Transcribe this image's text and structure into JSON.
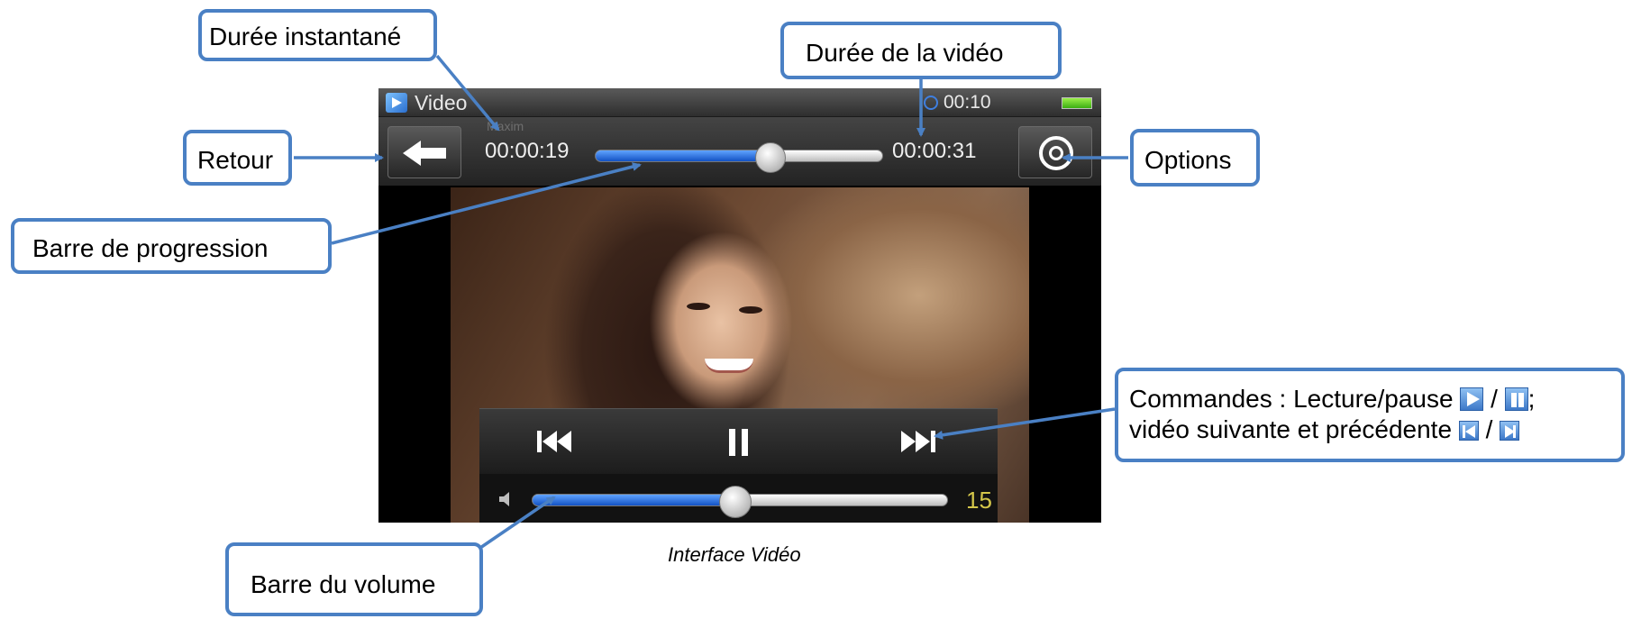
{
  "status_bar": {
    "app_title": "Video",
    "clock": "00:10"
  },
  "player": {
    "track_name": "Maxim",
    "time_current": "00:00:19",
    "time_total": "00:00:31",
    "progress_fraction": 0.61,
    "volume": {
      "value": "15",
      "level_fraction": 0.49
    }
  },
  "icons": {
    "app": "video-clapper-icon",
    "clock": "clock-icon",
    "battery": "battery-icon",
    "back": "back-arrow-icon",
    "options": "gear-icon",
    "previous": "skip-previous-icon",
    "pause": "pause-icon",
    "next": "skip-next-icon",
    "volume": "speaker-icon"
  },
  "annotations": {
    "instant": "Durée instantané",
    "duration": "Durée de la vidéo",
    "back": "Retour",
    "options": "Options",
    "progress": "Barre de progression",
    "commands_line1": "Commandes : Lecture/pause",
    "commands_sep": "/",
    "commands_end": ";",
    "commands_line2": "vidéo suivante et précédente",
    "volume": "Barre du volume"
  },
  "caption": "Interface Vidéo",
  "colors": {
    "accent": "#4a80c4",
    "progress": "#1f66d6",
    "volume_text": "#d4c64a"
  }
}
